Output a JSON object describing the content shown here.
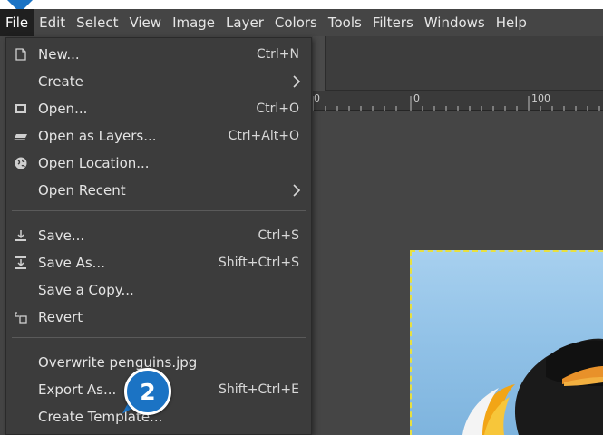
{
  "menubar": {
    "items": [
      "File",
      "Edit",
      "Select",
      "View",
      "Image",
      "Layer",
      "Colors",
      "Tools",
      "Filters",
      "Windows",
      "Help"
    ]
  },
  "ruler": {
    "labels": [
      "0",
      "0",
      "100"
    ]
  },
  "file_menu": {
    "items": [
      {
        "label": "New...",
        "shortcut": "Ctrl+N",
        "icon": "new-file-icon"
      },
      {
        "label": "Create",
        "shortcut": "",
        "icon": "",
        "submenu": true
      },
      {
        "label": "Open...",
        "shortcut": "Ctrl+O",
        "icon": "open-image-icon"
      },
      {
        "label": "Open as Layers...",
        "shortcut": "Ctrl+Alt+O",
        "icon": "layers-icon"
      },
      {
        "label": "Open Location...",
        "shortcut": "",
        "icon": "globe-icon"
      },
      {
        "label": "Open Recent",
        "shortcut": "",
        "icon": "",
        "submenu": true
      },
      {
        "label": "Save...",
        "shortcut": "Ctrl+S",
        "icon": "save-icon"
      },
      {
        "label": "Save As...",
        "shortcut": "Shift+Ctrl+S",
        "icon": "save-as-icon"
      },
      {
        "label": "Save a Copy...",
        "shortcut": "",
        "icon": ""
      },
      {
        "label": "Revert",
        "shortcut": "",
        "icon": "revert-icon"
      },
      {
        "label": "Overwrite penguins.jpg",
        "shortcut": "",
        "icon": ""
      },
      {
        "label": "Export As...",
        "shortcut": "Shift+Ctrl+E",
        "icon": ""
      },
      {
        "label": "Create Template...",
        "shortcut": "",
        "icon": ""
      }
    ]
  },
  "callout": {
    "number": "2",
    "color": "#1b73c4"
  },
  "colors": {
    "menu_bg": "#3c3c3c",
    "app_bg": "#454545",
    "selection_border": "#e8e040"
  }
}
